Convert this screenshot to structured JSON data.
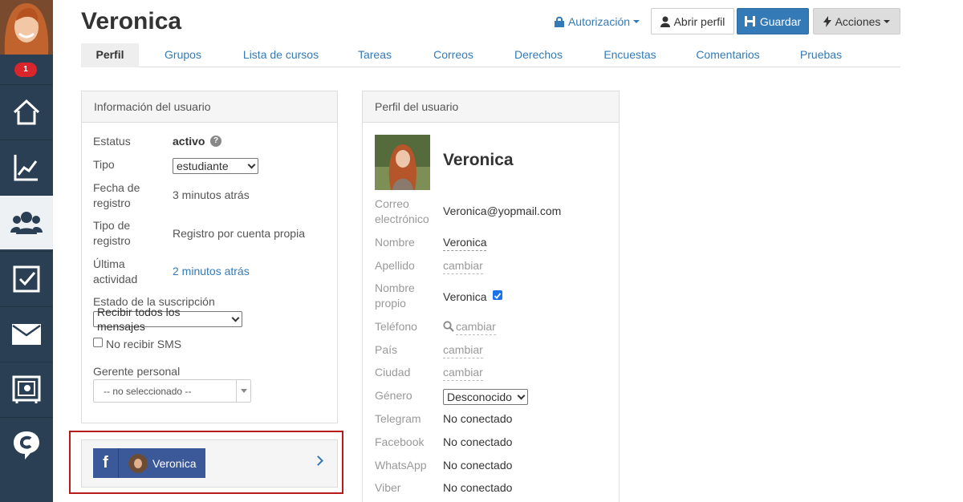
{
  "sidebar": {
    "badge": "1",
    "items": [
      {
        "icon": "home-icon"
      },
      {
        "icon": "chart-icon"
      },
      {
        "icon": "users-icon"
      },
      {
        "icon": "tasks-icon"
      },
      {
        "icon": "mail-icon"
      },
      {
        "icon": "safe-icon"
      },
      {
        "icon": "chat-icon"
      }
    ]
  },
  "header": {
    "title": "Veronica",
    "auth_label": "Autorización",
    "open_profile_label": "Abrir perfil",
    "save_label": "Guardar",
    "actions_label": "Acciones"
  },
  "tabs": [
    "Perfil",
    "Grupos",
    "Lista de cursos",
    "Tareas",
    "Correos",
    "Derechos",
    "Encuestas",
    "Comentarios",
    "Pruebas"
  ],
  "user_info": {
    "title": "Información del usuario",
    "status_label": "Estatus",
    "status_value": "activo",
    "type_label": "Tipo",
    "type_value": "estudiante",
    "reg_date_label_1": "Fecha de",
    "reg_date_label_2": "registro",
    "reg_date_value": "3 minutos atrás",
    "reg_type_label_1": "Tipo de",
    "reg_type_label_2": "registro",
    "reg_type_value": "Registro por cuenta propia",
    "last_activity_label_1": "Última",
    "last_activity_label_2": "actividad",
    "last_activity_value": "2 minutos atrás",
    "subscription_label": "Estado de la suscripción",
    "subscription_value": "Recibir todos los mensajes",
    "no_sms_label": "No recibir SMS",
    "manager_label": "Gerente personal",
    "manager_value": "-- no seleccionado --"
  },
  "facebook": {
    "name": "Veronica"
  },
  "user_profile": {
    "title": "Perfil del usuario",
    "name": "Veronica",
    "email_label_1": "Correo",
    "email_label_2": "electrónico",
    "email_value": "Veronica@yopmail.com",
    "first_name_label": "Nombre",
    "first_name_value": "Veronica",
    "last_name_label": "Apellido",
    "last_name_value": "cambiar",
    "own_name_label_1": "Nombre",
    "own_name_label_2": "propio",
    "own_name_value": "Veronica",
    "phone_label": "Teléfono",
    "phone_value": "cambiar",
    "country_label": "País",
    "country_value": "cambiar",
    "city_label": "Ciudad",
    "city_value": "cambiar",
    "gender_label": "Género",
    "gender_value": "Desconocido",
    "telegram_label": "Telegram",
    "telegram_value": "No conectado",
    "facebook_label": "Facebook",
    "facebook_value": "No conectado",
    "whatsapp_label": "WhatsApp",
    "whatsapp_value": "No conectado",
    "viber_label": "Viber",
    "viber_value": "No conectado"
  },
  "colors": {
    "sidebar": "#2a3f54",
    "link": "#337ab7",
    "primary": "#337ab7",
    "badge": "#d9262c",
    "facebook": "#3b5998",
    "highlight": "#b71c1c"
  }
}
